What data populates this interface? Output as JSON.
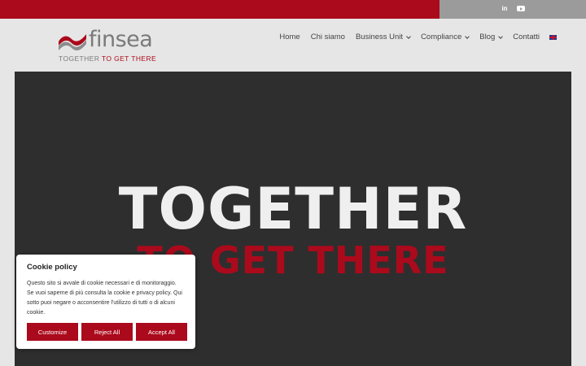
{
  "header": {
    "logo_word": "finsea",
    "tagline_part1": "TOGETHER ",
    "tagline_part2": "TO GET THERE",
    "nav": [
      {
        "label": "Home"
      },
      {
        "label": "Chi siamo"
      },
      {
        "label": "Business Unit"
      },
      {
        "label": "Compliance"
      },
      {
        "label": "Blog"
      },
      {
        "label": "Contatti"
      }
    ]
  },
  "topbar": {
    "icons": [
      "linkedin-icon",
      "youtube-icon"
    ],
    "linkedin_glyph": "in"
  },
  "hero": {
    "title": "TOGETHER",
    "subtitle": "TO GET THERE"
  },
  "cookie": {
    "title": "Cookie policy",
    "text": "Questo sito si avvale di cookie necessari e di monitoraggio. Se vuoi saperne di più consulta la cookie e privacy policy. Qui sotto puoi negare o acconsentire l'utilizzo di tutti o di alcuni cookie.",
    "customize": "Customize",
    "reject": "Reject All",
    "accept": "Accept All"
  },
  "colors": {
    "brand_red": "#ab0a1c",
    "gray": "#9b9b9b",
    "hero_bg": "#2e2e2e"
  }
}
